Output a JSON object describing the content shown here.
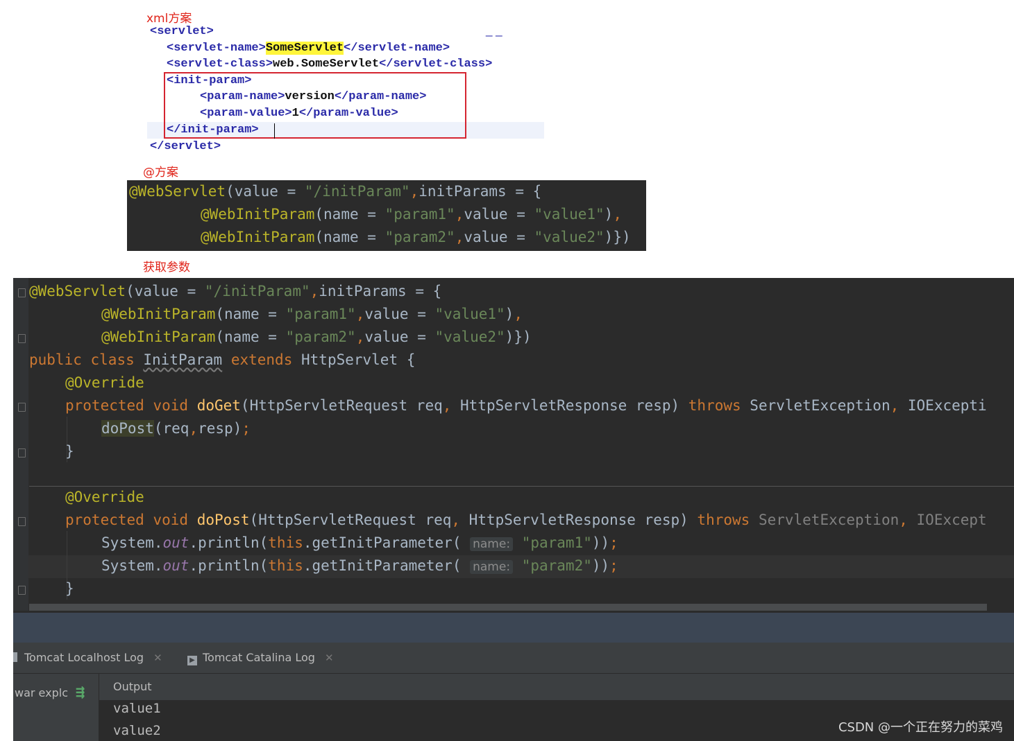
{
  "labels": {
    "xml_scheme": "xml方案",
    "anno_scheme": "@方案",
    "get_params": "获取参数"
  },
  "xml": {
    "l1": "<servlet>",
    "l2_open": "<servlet-name>",
    "l2_val": "SomeServlet",
    "l2_close": "</servlet-name>",
    "l3_open": "<servlet-class>",
    "l3_val": "web.SomeServlet",
    "l3_close": "</servlet-class>",
    "l4": "<init-param>",
    "l5_open": "<param-name>",
    "l5_val": "version",
    "l5_close": "</param-name>",
    "l6_open": "<param-value>",
    "l6_val": "1",
    "l6_close": "</param-value>",
    "l7": "</init-param>",
    "l8": "</servlet>",
    "dashes": "_ _"
  },
  "annotation_code": {
    "webservlet": "@WebServlet",
    "value_kw": "value",
    "value_str": "\"/initParam\"",
    "initparams_kw": "initParams",
    "webinitparam": "@WebInitParam",
    "name_kw": "name",
    "p1": "\"param1\"",
    "v1": "\"value1\"",
    "p2": "\"param2\"",
    "v2": "\"value2\""
  },
  "ide": {
    "public": "public",
    "class": "class",
    "class_name": "InitParam",
    "extends": "extends",
    "super_name": "HttpServlet",
    "override": "@Override",
    "protected": "protected",
    "void": "void",
    "doGet": "doGet",
    "doPost": "doPost",
    "req_type": "HttpServletRequest",
    "req": "req",
    "resp_type": "HttpServletResponse",
    "resp": "resp",
    "throws": "throws",
    "ex1": "ServletException",
    "ex2_get": "IOExcepti",
    "ex2_post": "IOExcept",
    "system": "System",
    "out": "out",
    "println": "println",
    "this": "this",
    "getInitParameter": "getInitParameter",
    "hint_name": "name:",
    "str_p1": "\"param1\"",
    "str_p2": "\"param2\""
  },
  "toolwindow": {
    "tab1": "Tomcat Localhost Log",
    "tab2": "Tomcat Catalina Log",
    "left_label": "war explc",
    "output_header": "Output",
    "output_lines": [
      "value1",
      "value2"
    ]
  },
  "watermark": "CSDN @一个正在努力的菜鸡",
  "colors": {
    "editor_bg": "#2b2b2b",
    "keyword": "#cc7832",
    "annotation": "#bbb529",
    "string": "#6a8759",
    "xml_tag": "#2a2aa8",
    "label_red": "#e0241a"
  }
}
